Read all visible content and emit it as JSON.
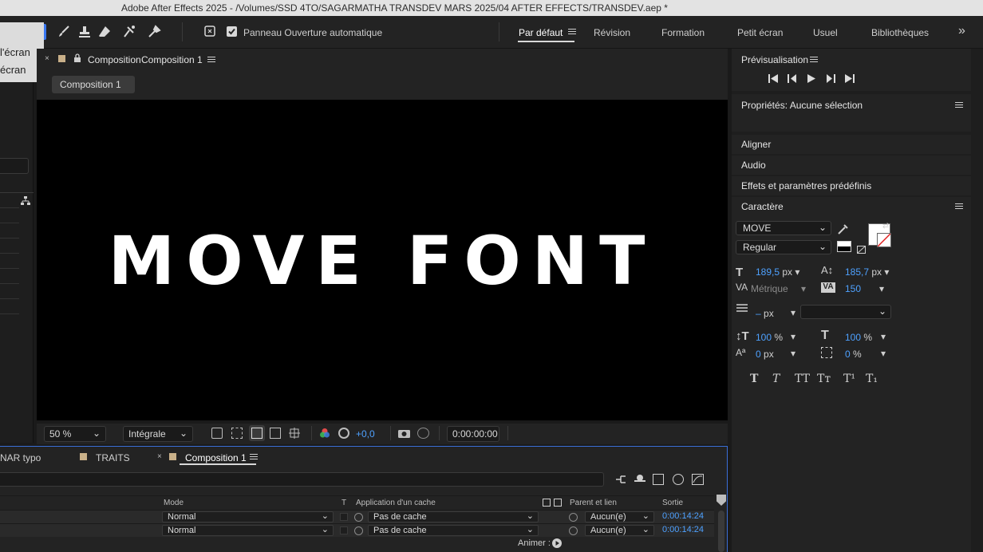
{
  "window": {
    "title": "Adobe After Effects 2025 - /Volumes/SSD 4TO/SAGARMATHA TRANSDEV MARS 2025/04 AFTER EFFECTS/TRANSDEV.aep *"
  },
  "toolbar": {
    "auto_open_label": "Panneau Ouverture automatique",
    "auto_open_checked": true,
    "workspaces": [
      "Par défaut",
      "Révision",
      "Formation",
      "Petit écran",
      "Usuel",
      "Bibliothèques"
    ],
    "more_label": "»"
  },
  "popover": {
    "items": [
      "l'écran",
      "écran"
    ]
  },
  "viewer": {
    "tab_label": "Composition",
    "tab_name": "Composition 1",
    "sub_tab": "Composition 1",
    "canvas_text": "MOVE FONT",
    "zoom": "50 %",
    "resolution": "Intégrale",
    "exposure": "+0,0",
    "timecode": "0:00:00:00"
  },
  "preview": {
    "title": "Prévisualisation"
  },
  "properties": {
    "title": "Propriétés: Aucune sélection"
  },
  "panels": {
    "align": "Aligner",
    "audio": "Audio",
    "effects": "Effets et paramètres prédéfinis"
  },
  "character": {
    "title": "Caractère",
    "font": "MOVE",
    "style": "Regular",
    "size": "189,5",
    "size_unit": "px",
    "leading": "185,7",
    "leading_unit": "px",
    "kerning": "Métrique",
    "tracking": "150",
    "stroke_width": "–",
    "stroke_unit": "px",
    "vscale": "100",
    "hscale": "100",
    "baseline": "0",
    "baseline_unit": "px",
    "tsume": "0",
    "percent": "%",
    "fill_color": "#ffffff",
    "accent_color": "#4ea1ff"
  },
  "timeline": {
    "tabs": [
      "NAR typo",
      "TRAITS",
      "Composition 1"
    ],
    "headers": {
      "mode": "Mode",
      "t": "T",
      "matte": "Application d'un cache",
      "parent": "Parent et lien",
      "out": "Sortie"
    },
    "rows": [
      {
        "mode": "Normal",
        "matte": "Pas de cache",
        "parent": "Aucun(e)",
        "out": "0:00:14:24"
      },
      {
        "mode": "Normal",
        "matte": "Pas de cache",
        "parent": "Aucun(e)",
        "out": "0:00:14:24"
      }
    ],
    "animate_label": "Animer :"
  }
}
